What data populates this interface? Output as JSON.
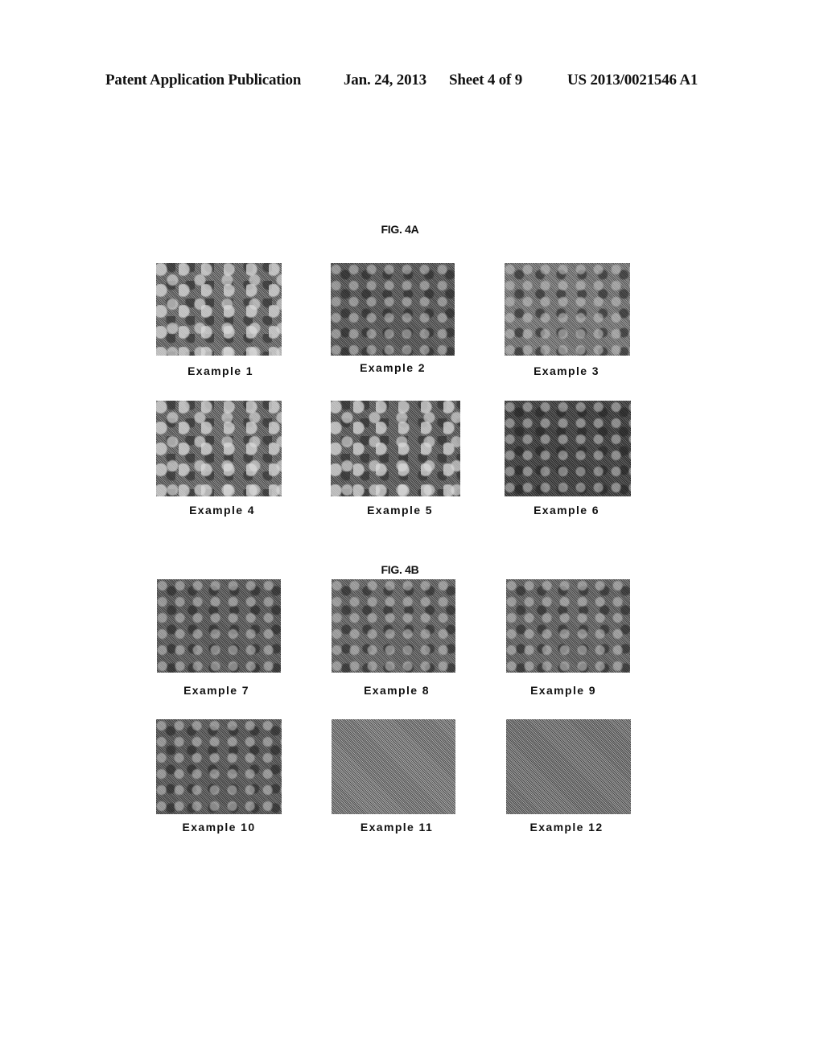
{
  "header": {
    "publication_type": "Patent Application Publication",
    "date": "Jan. 24, 2013",
    "sheet": "Sheet 4 of 9",
    "publication_number": "US 2013/0021546 A1"
  },
  "figures": [
    {
      "title": "FIG. 4A",
      "panels": [
        {
          "caption": "Example 1",
          "image": "micrograph",
          "shade": "#6e6e6e"
        },
        {
          "caption": "Example 2",
          "image": "micrograph",
          "shade": "#5a5a5a"
        },
        {
          "caption": "Example 3",
          "image": "micrograph",
          "shade": "#808080"
        },
        {
          "caption": "Example 4",
          "image": "micrograph",
          "shade": "#6a6a6a"
        },
        {
          "caption": "Example 5",
          "image": "micrograph",
          "shade": "#5e5e5e"
        },
        {
          "caption": "Example 6",
          "image": "micrograph",
          "shade": "#3c3c3c"
        }
      ]
    },
    {
      "title": "FIG. 4B",
      "panels": [
        {
          "caption": "Example 7",
          "image": "micrograph",
          "shade": "#5c5c5c"
        },
        {
          "caption": "Example 8",
          "image": "micrograph",
          "shade": "#6a6a6a"
        },
        {
          "caption": "Example 9",
          "image": "micrograph",
          "shade": "#686868"
        },
        {
          "caption": "Example 10",
          "image": "micrograph",
          "shade": "#5a5a5a"
        },
        {
          "caption": "Example 11",
          "image": "micrograph",
          "shade": "#858585"
        },
        {
          "caption": "Example 12",
          "image": "micrograph",
          "shade": "#7a7a7a"
        }
      ]
    }
  ]
}
